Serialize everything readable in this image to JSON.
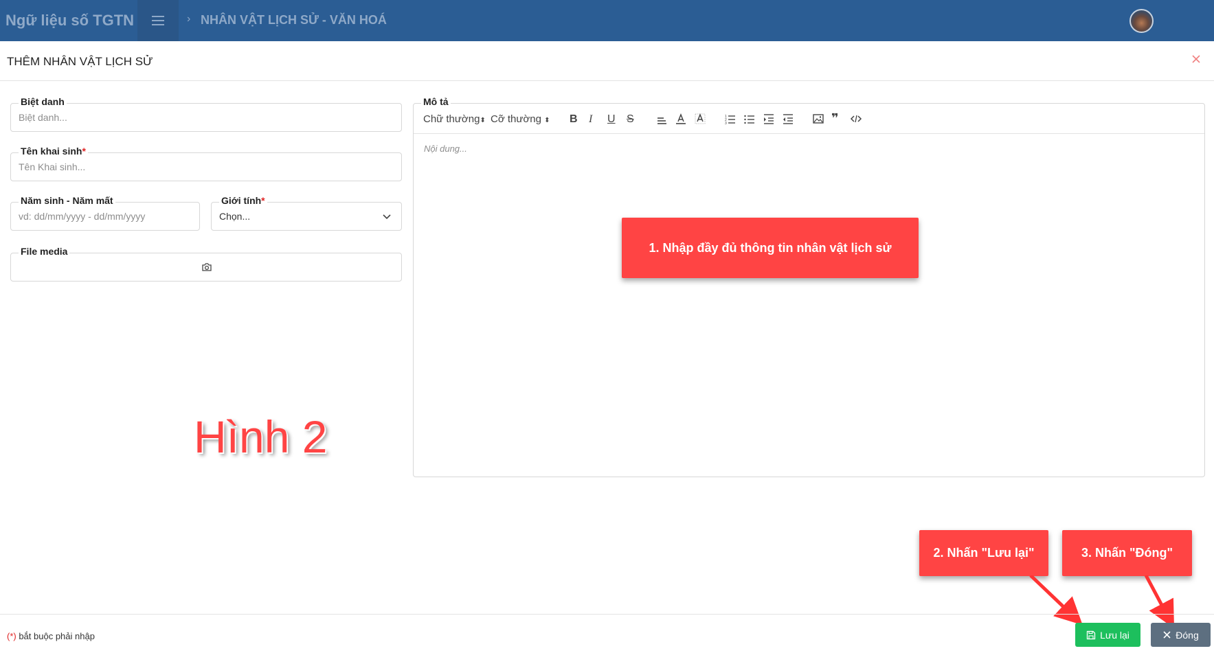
{
  "header": {
    "brand": "Ngữ liệu số TGTN",
    "breadcrumb": "NHÂN VẬT LỊCH SỬ - VĂN HOÁ"
  },
  "modal": {
    "title": "THÊM NHÂN VẬT LỊCH SỬ"
  },
  "form": {
    "nickname": {
      "label": "Biệt danh",
      "placeholder": "Biệt danh..."
    },
    "birth_name": {
      "label": "Tên khai sinh",
      "required_mark": "*",
      "placeholder": "Tên Khai sinh..."
    },
    "years": {
      "label": "Năm sinh - Năm mất",
      "placeholder": "vd: dd/mm/yyyy - dd/mm/yyyy"
    },
    "gender": {
      "label": "Giới tính",
      "required_mark": "*",
      "value": "Chọn..."
    },
    "media": {
      "label": "File media"
    },
    "description": {
      "label": "Mô tả",
      "font_style": "Chữ thường",
      "font_size": "Cỡ thường",
      "placeholder": "Nội dung..."
    }
  },
  "annotations": {
    "step1": "1. Nhập đầy đủ thông tin nhân vật lịch sử",
    "step2": "2. Nhấn \"Lưu lại\"",
    "step3": "3. Nhấn \"Đóng\"",
    "figure_label": "Hình 2"
  },
  "footer": {
    "required_mark": "(*)",
    "required_note": " bắt buộc phải nhập",
    "save_label": "Lưu lại",
    "close_label": "Đóng"
  },
  "colors": {
    "topbar": "#2b5d94",
    "callout": "#ff4444",
    "save": "#1dbf5d",
    "close": "#5d6f80"
  }
}
